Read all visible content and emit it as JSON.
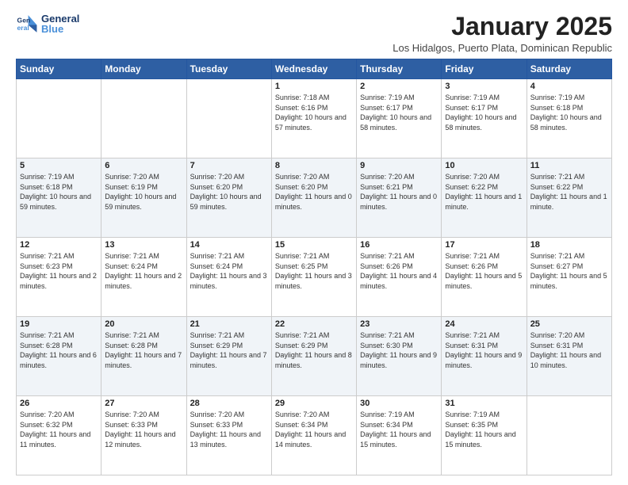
{
  "logo": {
    "text_general": "General",
    "text_blue": "Blue"
  },
  "header": {
    "month": "January 2025",
    "location": "Los Hidalgos, Puerto Plata, Dominican Republic"
  },
  "days_of_week": [
    "Sunday",
    "Monday",
    "Tuesday",
    "Wednesday",
    "Thursday",
    "Friday",
    "Saturday"
  ],
  "weeks": [
    {
      "days": [
        {
          "num": "",
          "info": ""
        },
        {
          "num": "",
          "info": ""
        },
        {
          "num": "",
          "info": ""
        },
        {
          "num": "1",
          "info": "Sunrise: 7:18 AM\nSunset: 6:16 PM\nDaylight: 10 hours and 57 minutes."
        },
        {
          "num": "2",
          "info": "Sunrise: 7:19 AM\nSunset: 6:17 PM\nDaylight: 10 hours and 58 minutes."
        },
        {
          "num": "3",
          "info": "Sunrise: 7:19 AM\nSunset: 6:17 PM\nDaylight: 10 hours and 58 minutes."
        },
        {
          "num": "4",
          "info": "Sunrise: 7:19 AM\nSunset: 6:18 PM\nDaylight: 10 hours and 58 minutes."
        }
      ]
    },
    {
      "days": [
        {
          "num": "5",
          "info": "Sunrise: 7:19 AM\nSunset: 6:18 PM\nDaylight: 10 hours and 59 minutes."
        },
        {
          "num": "6",
          "info": "Sunrise: 7:20 AM\nSunset: 6:19 PM\nDaylight: 10 hours and 59 minutes."
        },
        {
          "num": "7",
          "info": "Sunrise: 7:20 AM\nSunset: 6:20 PM\nDaylight: 10 hours and 59 minutes."
        },
        {
          "num": "8",
          "info": "Sunrise: 7:20 AM\nSunset: 6:20 PM\nDaylight: 11 hours and 0 minutes."
        },
        {
          "num": "9",
          "info": "Sunrise: 7:20 AM\nSunset: 6:21 PM\nDaylight: 11 hours and 0 minutes."
        },
        {
          "num": "10",
          "info": "Sunrise: 7:20 AM\nSunset: 6:22 PM\nDaylight: 11 hours and 1 minute."
        },
        {
          "num": "11",
          "info": "Sunrise: 7:21 AM\nSunset: 6:22 PM\nDaylight: 11 hours and 1 minute."
        }
      ]
    },
    {
      "days": [
        {
          "num": "12",
          "info": "Sunrise: 7:21 AM\nSunset: 6:23 PM\nDaylight: 11 hours and 2 minutes."
        },
        {
          "num": "13",
          "info": "Sunrise: 7:21 AM\nSunset: 6:24 PM\nDaylight: 11 hours and 2 minutes."
        },
        {
          "num": "14",
          "info": "Sunrise: 7:21 AM\nSunset: 6:24 PM\nDaylight: 11 hours and 3 minutes."
        },
        {
          "num": "15",
          "info": "Sunrise: 7:21 AM\nSunset: 6:25 PM\nDaylight: 11 hours and 3 minutes."
        },
        {
          "num": "16",
          "info": "Sunrise: 7:21 AM\nSunset: 6:26 PM\nDaylight: 11 hours and 4 minutes."
        },
        {
          "num": "17",
          "info": "Sunrise: 7:21 AM\nSunset: 6:26 PM\nDaylight: 11 hours and 5 minutes."
        },
        {
          "num": "18",
          "info": "Sunrise: 7:21 AM\nSunset: 6:27 PM\nDaylight: 11 hours and 5 minutes."
        }
      ]
    },
    {
      "days": [
        {
          "num": "19",
          "info": "Sunrise: 7:21 AM\nSunset: 6:28 PM\nDaylight: 11 hours and 6 minutes."
        },
        {
          "num": "20",
          "info": "Sunrise: 7:21 AM\nSunset: 6:28 PM\nDaylight: 11 hours and 7 minutes."
        },
        {
          "num": "21",
          "info": "Sunrise: 7:21 AM\nSunset: 6:29 PM\nDaylight: 11 hours and 7 minutes."
        },
        {
          "num": "22",
          "info": "Sunrise: 7:21 AM\nSunset: 6:29 PM\nDaylight: 11 hours and 8 minutes."
        },
        {
          "num": "23",
          "info": "Sunrise: 7:21 AM\nSunset: 6:30 PM\nDaylight: 11 hours and 9 minutes."
        },
        {
          "num": "24",
          "info": "Sunrise: 7:21 AM\nSunset: 6:31 PM\nDaylight: 11 hours and 9 minutes."
        },
        {
          "num": "25",
          "info": "Sunrise: 7:20 AM\nSunset: 6:31 PM\nDaylight: 11 hours and 10 minutes."
        }
      ]
    },
    {
      "days": [
        {
          "num": "26",
          "info": "Sunrise: 7:20 AM\nSunset: 6:32 PM\nDaylight: 11 hours and 11 minutes."
        },
        {
          "num": "27",
          "info": "Sunrise: 7:20 AM\nSunset: 6:33 PM\nDaylight: 11 hours and 12 minutes."
        },
        {
          "num": "28",
          "info": "Sunrise: 7:20 AM\nSunset: 6:33 PM\nDaylight: 11 hours and 13 minutes."
        },
        {
          "num": "29",
          "info": "Sunrise: 7:20 AM\nSunset: 6:34 PM\nDaylight: 11 hours and 14 minutes."
        },
        {
          "num": "30",
          "info": "Sunrise: 7:19 AM\nSunset: 6:34 PM\nDaylight: 11 hours and 15 minutes."
        },
        {
          "num": "31",
          "info": "Sunrise: 7:19 AM\nSunset: 6:35 PM\nDaylight: 11 hours and 15 minutes."
        },
        {
          "num": "",
          "info": ""
        }
      ]
    }
  ]
}
